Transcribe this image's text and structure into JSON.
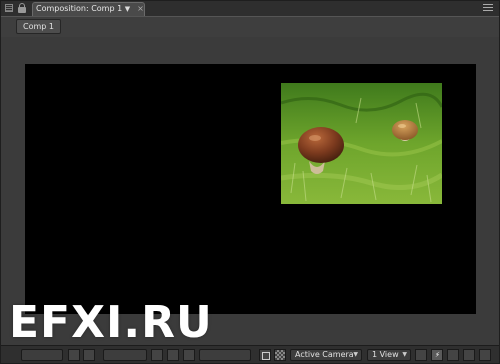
{
  "panel": {
    "tab_title": "Composition: Comp 1",
    "breadcrumb": "Comp 1"
  },
  "toolbar": {
    "camera_view": "Active Camera",
    "view_layout": "1 View"
  },
  "watermark": "EFXI.RU",
  "icons": [
    "panel-grip-icon",
    "lock-icon",
    "tab-menu-arrow-icon",
    "tab-close-icon",
    "panel-flyout-menu-icon",
    "region-of-interest-icon",
    "transparency-grid-icon",
    "fast-preview-icon",
    "timeline-icon",
    "flowchart-icon"
  ],
  "colors": {
    "panel_bg": "#3e3e3e",
    "comp_bg": "#000000"
  }
}
